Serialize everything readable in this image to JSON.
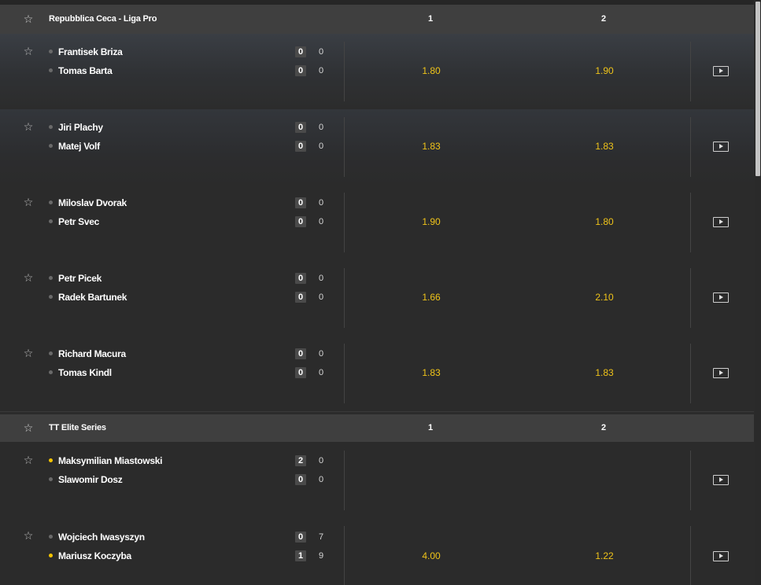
{
  "leagues": [
    {
      "name": "Repubblica Ceca - Liga Pro",
      "col1": "1",
      "col2": "2",
      "matches": [
        {
          "p1": {
            "name": "Frantisek Briza",
            "sets": "0",
            "games": "0",
            "serving": false
          },
          "p2": {
            "name": "Tomas Barta",
            "sets": "0",
            "games": "0",
            "serving": false
          },
          "odd1": "1.80",
          "odd2": "1.90"
        },
        {
          "p1": {
            "name": "Jiri Plachy",
            "sets": "0",
            "games": "0",
            "serving": false
          },
          "p2": {
            "name": "Matej Volf",
            "sets": "0",
            "games": "0",
            "serving": false
          },
          "odd1": "1.83",
          "odd2": "1.83"
        },
        {
          "p1": {
            "name": "Miloslav Dvorak",
            "sets": "0",
            "games": "0",
            "serving": false
          },
          "p2": {
            "name": "Petr Svec",
            "sets": "0",
            "games": "0",
            "serving": false
          },
          "odd1": "1.90",
          "odd2": "1.80"
        },
        {
          "p1": {
            "name": "Petr Picek",
            "sets": "0",
            "games": "0",
            "serving": false
          },
          "p2": {
            "name": "Radek Bartunek",
            "sets": "0",
            "games": "0",
            "serving": false
          },
          "odd1": "1.66",
          "odd2": "2.10"
        },
        {
          "p1": {
            "name": "Richard Macura",
            "sets": "0",
            "games": "0",
            "serving": false
          },
          "p2": {
            "name": "Tomas Kindl",
            "sets": "0",
            "games": "0",
            "serving": false
          },
          "odd1": "1.83",
          "odd2": "1.83"
        }
      ]
    },
    {
      "name": "TT Elite Series",
      "col1": "1",
      "col2": "2",
      "matches": [
        {
          "p1": {
            "name": "Maksymilian Miastowski",
            "sets": "2",
            "games": "0",
            "serving": true
          },
          "p2": {
            "name": "Slawomir Dosz",
            "sets": "0",
            "games": "0",
            "serving": false
          },
          "odd1": "",
          "odd2": ""
        },
        {
          "p1": {
            "name": "Wojciech Iwasyszyn",
            "sets": "0",
            "games": "7",
            "serving": false
          },
          "p2": {
            "name": "Mariusz Koczyba",
            "sets": "1",
            "games": "9",
            "serving": true
          },
          "odd1": "4.00",
          "odd2": "1.22"
        }
      ]
    }
  ],
  "icons": {
    "favorite": "star-icon",
    "stream": "live-stream-icon"
  },
  "colors": {
    "odds": "#f0c419",
    "serve_dot": "#f5c400",
    "header_bg": "#3f3f3f",
    "bg": "#2b2b2b"
  }
}
